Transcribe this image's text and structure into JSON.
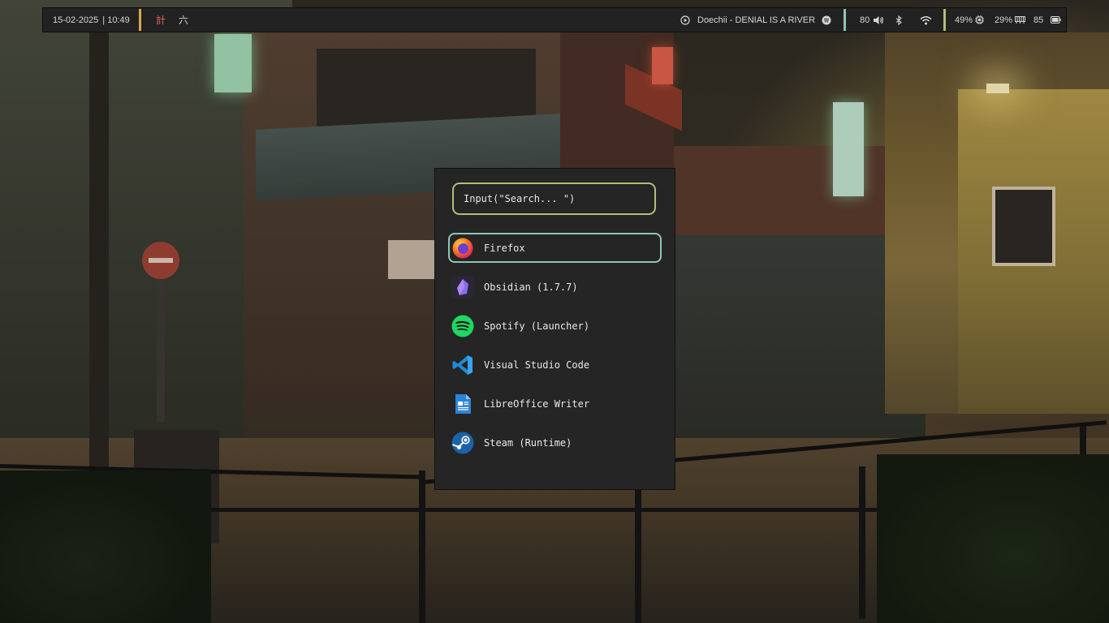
{
  "topbar": {
    "date": "15-02-2025",
    "time": "| 10:49",
    "workspace_1": "計",
    "workspace_2": "六",
    "now_playing": "Doechii - DENIAL IS A RIVER",
    "volume": "80",
    "battery_1": "49%",
    "battery_2": "29%",
    "battery_3": "85",
    "colors": {
      "background": "#222222",
      "separator_left": "#d9a94a",
      "separator_mid": "#8fc6b6",
      "separator_right": "#b9bb7a",
      "workspace_active": "#e46a5a"
    },
    "icons": [
      "play-circle-icon",
      "spotify-icon",
      "volume-icon",
      "bluetooth-icon",
      "wifi-icon",
      "cpu-icon",
      "memory-icon",
      "battery-icon"
    ]
  },
  "launcher": {
    "search_text": "Input(\"Search... \")",
    "colors": {
      "background": "#252525",
      "search_border": "#b9bb7a",
      "selected_border": "#8fc6b6"
    },
    "items": [
      {
        "label": "Firefox",
        "icon": "firefox-icon",
        "selected": true
      },
      {
        "label": "Obsidian (1.7.7)",
        "icon": "obsidian-icon",
        "selected": false
      },
      {
        "label": "Spotify (Launcher)",
        "icon": "spotify-icon",
        "selected": false
      },
      {
        "label": "Visual Studio Code",
        "icon": "vscode-icon",
        "selected": false
      },
      {
        "label": "LibreOffice Writer",
        "icon": "libreoffice-writer-icon",
        "selected": false
      },
      {
        "label": "Steam (Runtime)",
        "icon": "steam-icon",
        "selected": false
      }
    ]
  }
}
